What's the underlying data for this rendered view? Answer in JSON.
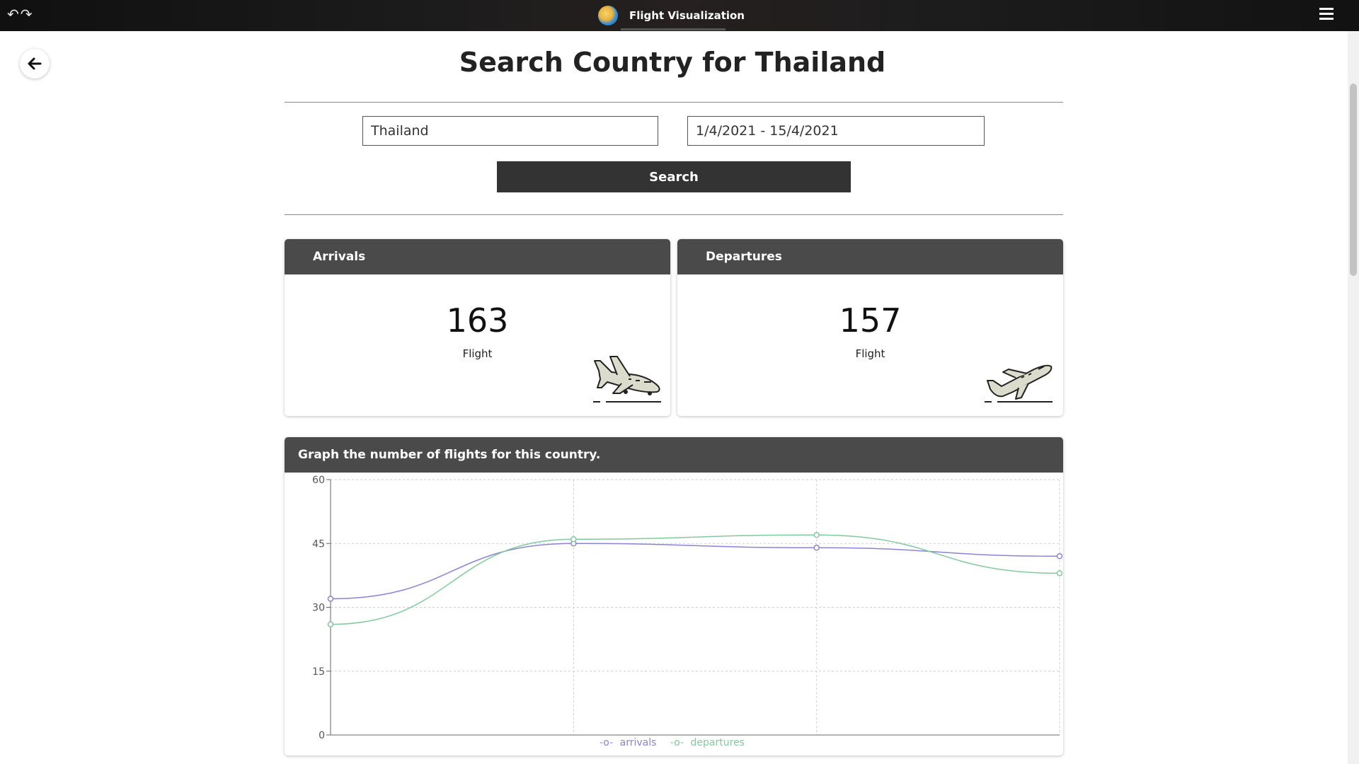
{
  "app": {
    "title": "Flight Visualization"
  },
  "page": {
    "title": "Search Country for Thailand"
  },
  "search": {
    "country_value": "Thailand",
    "date_range_value": "1/4/2021 - 15/4/2021",
    "button_label": "Search"
  },
  "cards": {
    "arrivals": {
      "title": "Arrivals",
      "count": "163",
      "unit": "Flight"
    },
    "departures": {
      "title": "Departures",
      "count": "157",
      "unit": "Flight"
    }
  },
  "graph": {
    "title": "Graph the number of flights for this country."
  },
  "icons": {
    "back": "arrow-left-icon",
    "menu": "hamburger-menu-icon",
    "nav_back": "undo-arrow-icon",
    "nav_forward": "redo-arrow-icon",
    "arrivals": "plane-landing-icon",
    "departures": "plane-takeoff-icon"
  },
  "colors": {
    "header": "#4a4a4a",
    "button": "#333333",
    "arrivals": "#8884d8",
    "departures": "#82ca9d"
  },
  "chart_data": {
    "type": "line",
    "x": [
      "",
      "",
      "",
      ""
    ],
    "ylim": [
      0,
      60
    ],
    "yticks": [
      "0",
      "15",
      "30",
      "45",
      "60"
    ],
    "grid": true,
    "legend": "bottom",
    "series": [
      {
        "name": "arrivals",
        "values": [
          32,
          45,
          44,
          42
        ]
      },
      {
        "name": "departures",
        "values": [
          26,
          46,
          47,
          38
        ]
      }
    ]
  }
}
